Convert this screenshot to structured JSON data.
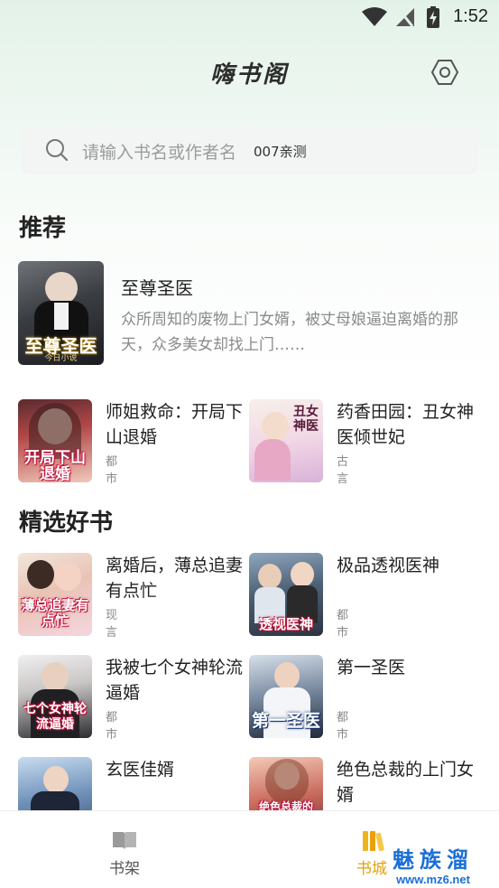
{
  "status_bar": {
    "time": "1:52"
  },
  "header": {
    "title": "嗨书阁"
  },
  "search": {
    "placeholder": "请输入书名或作者名",
    "tag": "007亲测"
  },
  "sections": {
    "recommend": "推荐",
    "selected": "精选好书"
  },
  "featured": {
    "title": "至尊圣医",
    "description": "众所周知的废物上门女婿，被丈母娘逼迫离婚的那天，众多美女却找上门……",
    "cover_text": "至尊圣医",
    "cover_subtext": "今日小说"
  },
  "recommend_books": [
    {
      "title": "师姐救命：开局下山退婚",
      "category": "都市",
      "cover_text": "开局下山退婚"
    },
    {
      "title": "药香田园：丑女神医倾世妃",
      "category": "古言",
      "cover_text": "丑女神医"
    }
  ],
  "selected_books": [
    {
      "title": "离婚后，薄总追妻有点忙",
      "category": "现言",
      "cover_text": "薄总追妻有点忙"
    },
    {
      "title": "极品透视医神",
      "category": "都市",
      "cover_text": "透视医神"
    },
    {
      "title": "我被七个女神轮流逼婚",
      "category": "都市",
      "cover_text": "七个女神轮流逼婚"
    },
    {
      "title": "第一圣医",
      "category": "都市",
      "cover_text": "第一圣医"
    },
    {
      "title": "玄医佳婿",
      "category": "",
      "cover_text": ""
    },
    {
      "title": "绝色总裁的上门女婿",
      "category": "",
      "cover_text": "绝色总裁的"
    }
  ],
  "bottom_nav": {
    "shelf": "书架",
    "store": "书城"
  },
  "watermark": {
    "title": "魅族溜",
    "url": "www.mz6.net"
  },
  "colors": {
    "accent": "#e2a20c",
    "background_top": "#e3f2e8",
    "watermark": "#1a6fd8"
  }
}
